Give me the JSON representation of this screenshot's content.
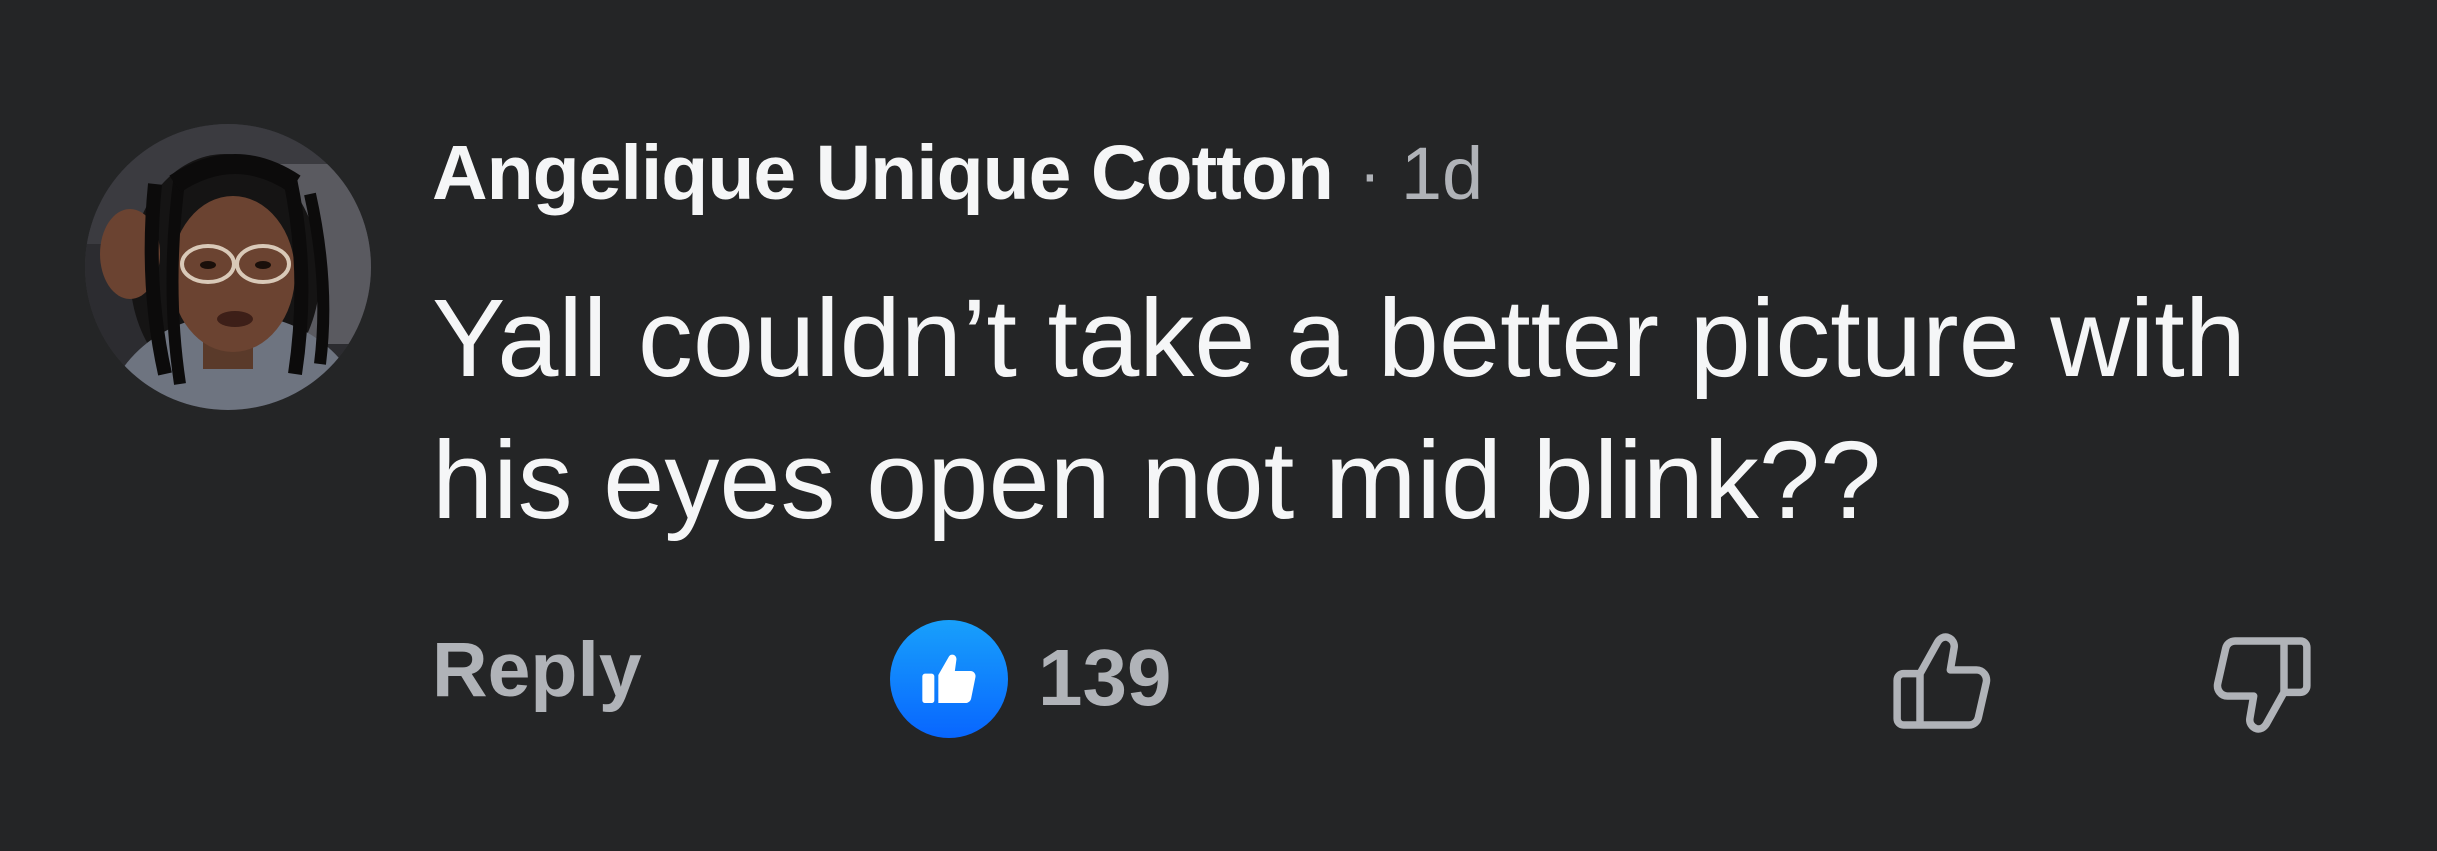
{
  "comment": {
    "author": "Angelique Unique Cotton",
    "separator": "·",
    "time": "1d",
    "text": "Yall couldn’t take a better picture with his eyes open not mid blink??"
  },
  "actions": {
    "reply_label": "Reply",
    "like_count": "139",
    "reaction_icon": "thumbs-up-filled-icon",
    "upvote_icon": "thumbs-up-outline-icon",
    "downvote_icon": "thumbs-down-outline-icon"
  },
  "colors": {
    "background": "#242526",
    "primary_text": "#f5f6f7",
    "secondary_text": "#b0b3b8",
    "like_badge": "#0866ff"
  }
}
